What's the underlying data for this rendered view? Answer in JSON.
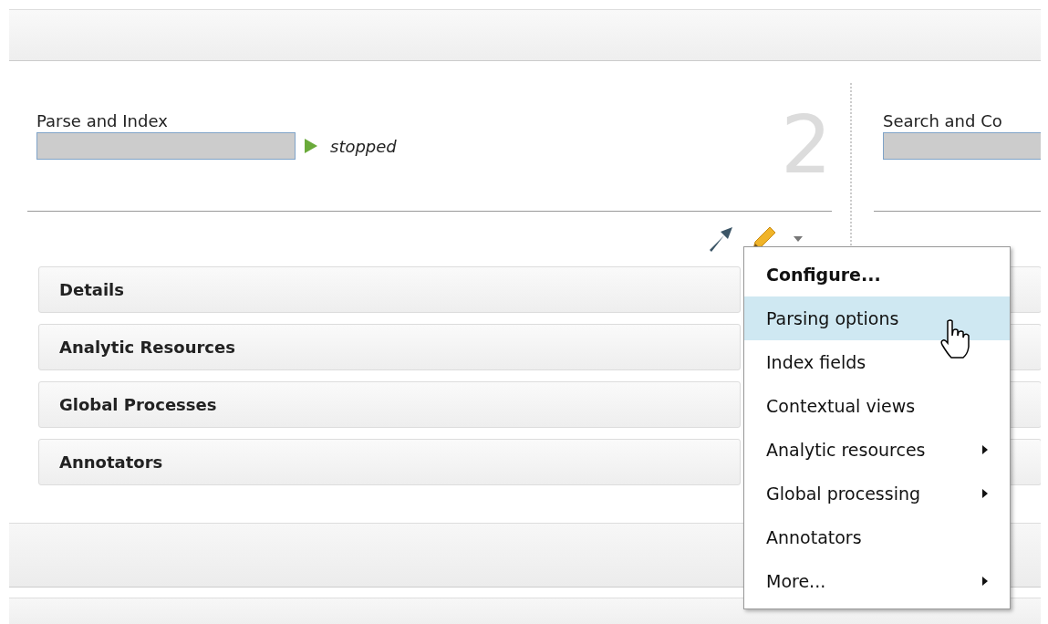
{
  "stages": [
    {
      "kind": "full",
      "title": "Parse and Index",
      "status": "stopped",
      "number": "2"
    },
    {
      "kind": "cut",
      "title": "Search and Co"
    }
  ],
  "panels": [
    {
      "label": "Details"
    },
    {
      "label": "Analytic Resources"
    },
    {
      "label": "Global Processes"
    },
    {
      "label": "Annotators"
    }
  ],
  "menu": {
    "items": [
      {
        "label": "Configure...",
        "kind": "bold",
        "selected": false,
        "submenu": false
      },
      {
        "label": "Parsing options",
        "kind": "normal",
        "selected": true,
        "submenu": false
      },
      {
        "label": "Index fields",
        "kind": "normal",
        "selected": false,
        "submenu": false
      },
      {
        "label": "Contextual views",
        "kind": "normal",
        "selected": false,
        "submenu": false
      },
      {
        "label": "Analytic resources",
        "kind": "normal",
        "selected": false,
        "submenu": true
      },
      {
        "label": "Global processing",
        "kind": "normal",
        "selected": false,
        "submenu": true
      },
      {
        "label": "Annotators",
        "kind": "normal",
        "selected": false,
        "submenu": false
      },
      {
        "label": "More...",
        "kind": "normal",
        "selected": false,
        "submenu": true
      }
    ]
  }
}
